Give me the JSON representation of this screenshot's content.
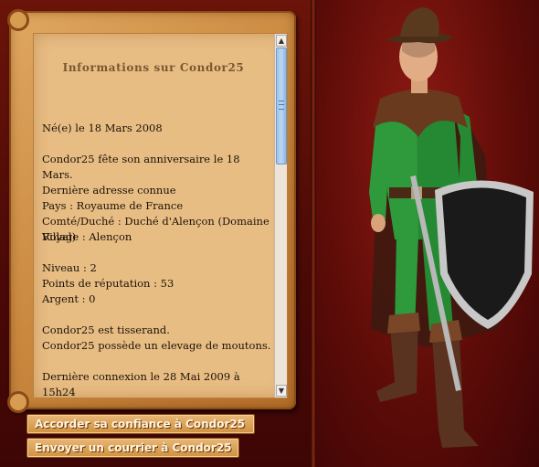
{
  "profile": {
    "title": "Informations sur Condor25",
    "lines": {
      "birth": "Né(e) le 18 Mars 2008",
      "anniversary": "Condor25 fête son anniversaire le 18 Mars.",
      "address_heading": "Dernière adresse connue",
      "country": "Pays : Royaume de France",
      "county": "Comté/Duché : Duché d'Alençon (Domaine Royal)",
      "village": "Village : Alençon",
      "level": "Niveau : 2",
      "reputation": "Points de réputation : 53",
      "money": "Argent : 0",
      "job": "Condor25 est tisserand.",
      "property": "Condor25 possède un elevage de moutons.",
      "last_login": "Dernière connexion le 28 Mai 2009 à 15h24"
    }
  },
  "actions": {
    "trust_label": "Accorder sa confiance à Condor25",
    "mail_label": "Envoyer un courrier à Condor25"
  },
  "scrollbar": {
    "up_glyph": "▲",
    "down_glyph": "▼"
  },
  "avatar": {
    "icon": "character-avatar",
    "colors": {
      "tunic": "#2e9a3c",
      "hat": "#5a3a1e",
      "shield": "#1a1a1a",
      "background": "#6e120c"
    }
  }
}
